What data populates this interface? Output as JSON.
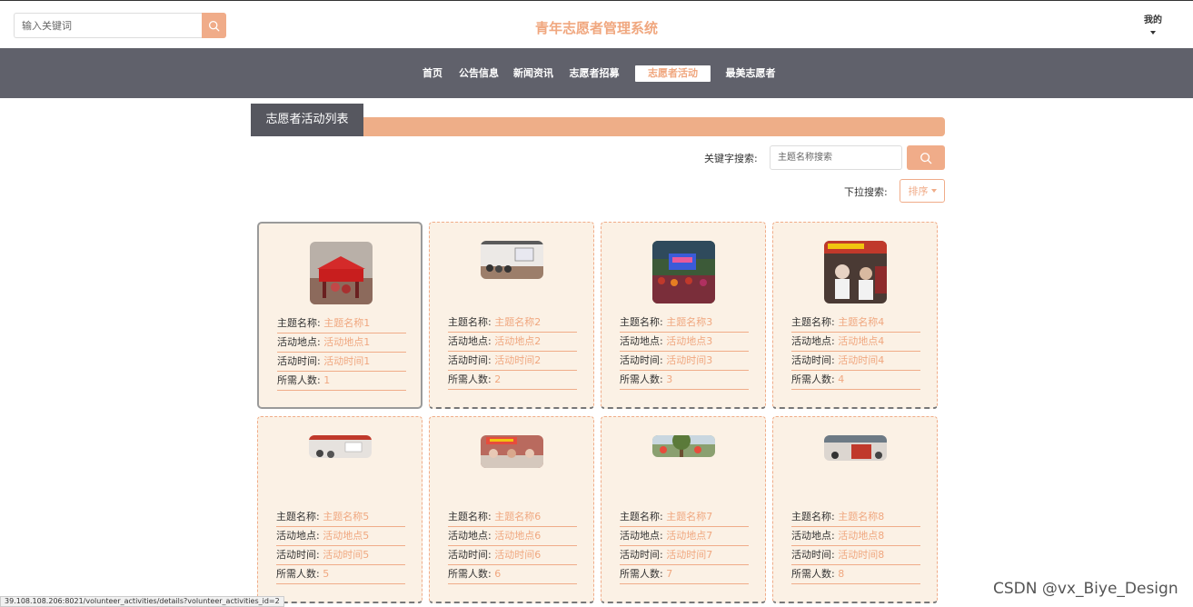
{
  "header": {
    "search_placeholder": "输入关键词",
    "site_title": "青年志愿者管理系统",
    "user_menu_label": "我的"
  },
  "nav": {
    "items": [
      {
        "label": "首页",
        "active": false
      },
      {
        "label": "公告信息",
        "active": false
      },
      {
        "label": "新闻资讯",
        "active": false
      },
      {
        "label": "志愿者招募",
        "active": false
      },
      {
        "label": "志愿者活动",
        "active": true
      },
      {
        "label": "最美志愿者",
        "active": false
      }
    ]
  },
  "section": {
    "title": "志愿者活动列表"
  },
  "filters": {
    "keyword_label": "关键字搜索:",
    "keyword_placeholder": "主题名称搜索",
    "dropdown_label": "下拉搜索:",
    "sort_label": "排序"
  },
  "field_labels": {
    "name": "主题名称:",
    "location": "活动地点:",
    "time": "活动时间:",
    "people": "所需人数:"
  },
  "cards": [
    {
      "name": "主题名称1",
      "location": "活动地点1",
      "time": "活动时间1",
      "people": "1",
      "image": "tent-photo"
    },
    {
      "name": "主题名称2",
      "location": "活动地点2",
      "time": "活动时间2",
      "people": "2",
      "image": "meeting-room-photo"
    },
    {
      "name": "主题名称3",
      "location": "活动地点3",
      "time": "活动时间3",
      "people": "3",
      "image": "crowd-stage-photo"
    },
    {
      "name": "主题名称4",
      "location": "活动地点4",
      "time": "活动时间4",
      "people": "4",
      "image": "volunteers-banner-photo"
    },
    {
      "name": "主题名称5",
      "location": "活动地点5",
      "time": "活动时间5",
      "people": "5",
      "image": "classroom-photo"
    },
    {
      "name": "主题名称6",
      "location": "活动地点6",
      "time": "活动时间6",
      "people": "6",
      "image": "group-table-photo"
    },
    {
      "name": "主题名称7",
      "location": "活动地点7",
      "time": "活动时间7",
      "people": "7",
      "image": "outdoor-trees-photo"
    },
    {
      "name": "主题名称8",
      "location": "活动地点8",
      "time": "活动时间8",
      "people": "8",
      "image": "indoor-red-photo"
    }
  ],
  "status_url": "39.108.108.206:8021/volunteer_activities/details?volunteer_activities_id=2",
  "watermark": "CSDN @vx_Biye_Design",
  "colors": {
    "accent": "#f0ac89",
    "nav_bg": "#60616b",
    "card_bg": "#fbf1e5"
  }
}
